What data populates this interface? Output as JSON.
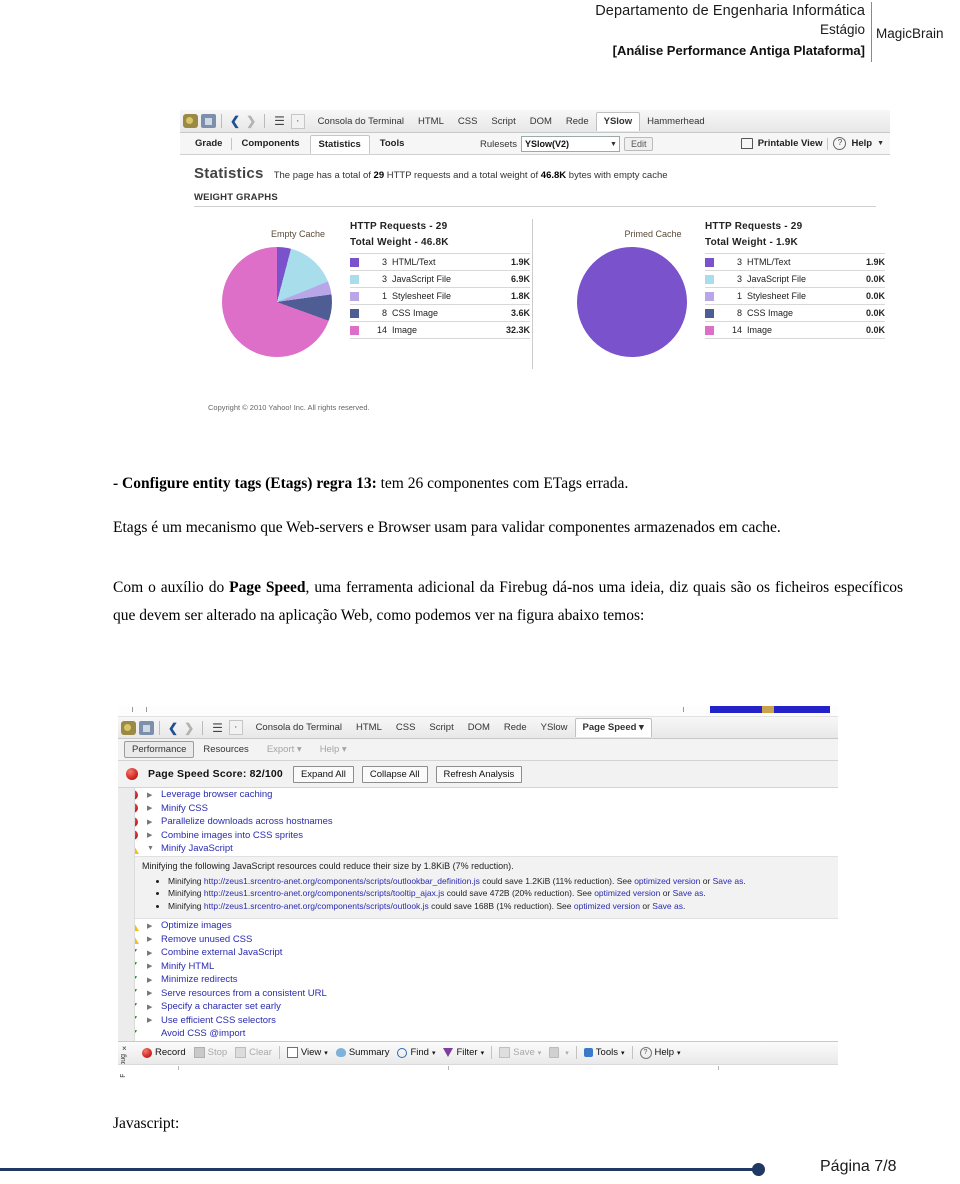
{
  "header": {
    "line1": "Departamento de Engenharia Informática",
    "line2": "Estágio",
    "line3": "[Análise Performance Antiga Plataforma]",
    "brand": "MagicBrain"
  },
  "yslow": {
    "panel_tabs": [
      "Consola do Terminal",
      "HTML",
      "CSS",
      "Script",
      "DOM",
      "Rede",
      "YSlow",
      "Hammerhead"
    ],
    "active_panel_tab": "YSlow",
    "sub_tabs": [
      "Grade",
      "Components",
      "Statistics",
      "Tools"
    ],
    "active_sub_tab": "Statistics",
    "rulesets_label": "Rulesets",
    "rulesets_value": "YSlow(V2)",
    "edit_label": "Edit",
    "printable_view": "Printable View",
    "help_label": "Help",
    "stat_title": "Statistics",
    "stat_desc_pre": "The page has a total of ",
    "stat_requests": "29",
    "stat_desc_mid": " HTTP requests and a total weight of ",
    "stat_weight": "46.8K",
    "stat_desc_post": " bytes with empty cache",
    "weight_graphs_label": "WEIGHT GRAPHS",
    "copyright": "Copyright © 2010 Yahoo! Inc. All rights reserved.",
    "empty_cache": {
      "cache_label": "Empty Cache",
      "requests_label": "HTTP Requests -  29",
      "weight_label": "Total Weight -  46.8K",
      "rows": [
        {
          "color": "#7a52cc",
          "count": "3",
          "name": "HTML/Text",
          "size": "1.9K"
        },
        {
          "color": "#a8ddec",
          "count": "3",
          "name": "JavaScript File",
          "size": "6.9K"
        },
        {
          "color": "#b9a6e8",
          "count": "1",
          "name": "Stylesheet File",
          "size": "1.8K"
        },
        {
          "color": "#4f5d95",
          "count": "8",
          "name": "CSS Image",
          "size": "3.6K"
        },
        {
          "color": "#dd6fc9",
          "count": "14",
          "name": "Image",
          "size": "32.3K"
        }
      ]
    },
    "primed_cache": {
      "cache_label": "Primed Cache",
      "requests_label": "HTTP Requests -  29",
      "weight_label": "Total Weight -  1.9K",
      "rows": [
        {
          "color": "#7a52cc",
          "count": "3",
          "name": "HTML/Text",
          "size": "1.9K"
        },
        {
          "color": "#a8ddec",
          "count": "3",
          "name": "JavaScript File",
          "size": "0.0K"
        },
        {
          "color": "#b9a6e8",
          "count": "1",
          "name": "Stylesheet File",
          "size": "0.0K"
        },
        {
          "color": "#4f5d95",
          "count": "8",
          "name": "CSS Image",
          "size": "0.0K"
        },
        {
          "color": "#dd6fc9",
          "count": "14",
          "name": "Image",
          "size": "0.0K"
        }
      ]
    }
  },
  "chart_data": [
    {
      "type": "pie",
      "title": "Empty Cache",
      "categories": [
        "HTML/Text",
        "JavaScript File",
        "Stylesheet File",
        "CSS Image",
        "Image"
      ],
      "values": [
        1.9,
        6.9,
        1.8,
        3.6,
        32.3
      ],
      "unit": "K",
      "counts": [
        3,
        3,
        1,
        8,
        14
      ],
      "colors": [
        "#7a52cc",
        "#a8ddec",
        "#b9a6e8",
        "#4f5d95",
        "#dd6fc9"
      ],
      "total_weight": "46.8K",
      "http_requests": 29,
      "legend": "right"
    },
    {
      "type": "pie",
      "title": "Primed Cache",
      "categories": [
        "HTML/Text",
        "JavaScript File",
        "Stylesheet File",
        "CSS Image",
        "Image"
      ],
      "values": [
        1.9,
        0.0,
        0.0,
        0.0,
        0.0
      ],
      "unit": "K",
      "counts": [
        3,
        3,
        1,
        8,
        14
      ],
      "colors": [
        "#7a52cc",
        "#a8ddec",
        "#b9a6e8",
        "#4f5d95",
        "#dd6fc9"
      ],
      "total_weight": "1.9K",
      "http_requests": 29,
      "legend": "right"
    }
  ],
  "body": {
    "para1_bold": "- Configure entity tags (Etags) regra 13:",
    "para1_rest": " tem 26 componentes com ETags errada.",
    "para2": "Etags é um mecanismo que Web-servers e Browser usam para validar componentes armazenados em cache.",
    "para3_a": "Com o auxílio do ",
    "para3_bold": "Page Speed",
    "para3_b": ", uma ferramenta adicional da Firebug dá-nos uma ideia, diz quais são os ficheiros específicos que devem ser alterado na aplicação Web, como podemos ver na figura abaixo temos:",
    "javascript_label": "Javascript:"
  },
  "pagespeed": {
    "panel_tabs": [
      "Consola do Terminal",
      "HTML",
      "CSS",
      "Script",
      "DOM",
      "Rede",
      "YSlow",
      "Page Speed"
    ],
    "active_panel_tab": "Page Speed",
    "sub_tabs": [
      "Performance",
      "Resources",
      "Export",
      "Help"
    ],
    "active_sub_tab": "Performance",
    "score_label": "Page Speed Score: 82/100",
    "buttons": [
      "Expand All",
      "Collapse All",
      "Refresh Analysis"
    ],
    "rules_top": [
      {
        "status": "red",
        "label": "Leverage browser caching"
      },
      {
        "status": "red",
        "label": "Minify CSS"
      },
      {
        "status": "red",
        "label": "Parallelize downloads across hostnames"
      },
      {
        "status": "red",
        "label": "Combine images into CSS sprites"
      },
      {
        "status": "warning",
        "label": "Minify JavaScript",
        "expanded": true
      }
    ],
    "detail": {
      "head": "Minifying the following JavaScript resources could reduce their size by 1.8KiB (7% reduction).",
      "items": [
        {
          "pre": "Minifying ",
          "url": "http://zeus1.srcentro-anet.org/components/scripts/outlookbar_definition.js",
          "mid": " could save 1.2KiB (11% reduction). See ",
          "link1": "optimized version",
          "sep": " or ",
          "link2": "Save as",
          "post": "."
        },
        {
          "pre": "Minifying ",
          "url": "http://zeus1.srcentro-anet.org/components/scripts/tooltip_ajax.js",
          "mid": " could save 472B (20% reduction). See ",
          "link1": "optimized version",
          "sep": " or ",
          "link2": "Save as",
          "post": "."
        },
        {
          "pre": "Minifying ",
          "url": "http://zeus1.srcentro-anet.org/components/scripts/outlook.js",
          "mid": " could save 168B (1% reduction). See ",
          "link1": "optimized version",
          "sep": " or ",
          "link2": "Save as",
          "post": "."
        }
      ]
    },
    "rules_bottom": [
      {
        "status": "warning",
        "label": "Optimize images"
      },
      {
        "status": "warning",
        "label": "Remove unused CSS"
      },
      {
        "status": "ok",
        "label": "Combine external JavaScript"
      },
      {
        "status": "ok",
        "label": "Minify HTML"
      },
      {
        "status": "ok",
        "label": "Minimize redirects"
      },
      {
        "status": "ok",
        "label": "Serve resources from a consistent URL"
      },
      {
        "status": "ok",
        "label": "Specify a character set early"
      },
      {
        "status": "ok",
        "label": "Use efficient CSS selectors"
      },
      {
        "status": "ok",
        "label": "Avoid CSS @import",
        "no_expander": true
      }
    ],
    "statusbar": {
      "vertical_tab": "Firebug",
      "close_label": "×",
      "items": [
        {
          "label": "Record",
          "icon": "record-icon",
          "dim": false,
          "caret": false
        },
        {
          "label": "Stop",
          "icon": "stop-icon",
          "dim": true,
          "caret": false
        },
        {
          "label": "Clear",
          "icon": "clear-icon",
          "dim": true,
          "caret": false
        },
        {
          "label": "View",
          "icon": "view-icon",
          "dim": false,
          "caret": true
        },
        {
          "label": "Summary",
          "icon": "summary-icon",
          "dim": false,
          "caret": false
        },
        {
          "label": "Find",
          "icon": "search-icon",
          "dim": false,
          "caret": true
        },
        {
          "label": "Filter",
          "icon": "filter-icon",
          "dim": false,
          "caret": true
        },
        {
          "label": "Save",
          "icon": "save-icon",
          "dim": true,
          "caret": true
        },
        {
          "label": "",
          "icon": "lock-icon",
          "dim": true,
          "caret": true
        },
        {
          "label": "Tools",
          "icon": "tools-icon",
          "dim": false,
          "caret": true
        },
        {
          "label": "Help",
          "icon": "help-icon",
          "dim": false,
          "caret": true
        }
      ]
    }
  },
  "footer": {
    "page_label": "Página 7/8"
  }
}
